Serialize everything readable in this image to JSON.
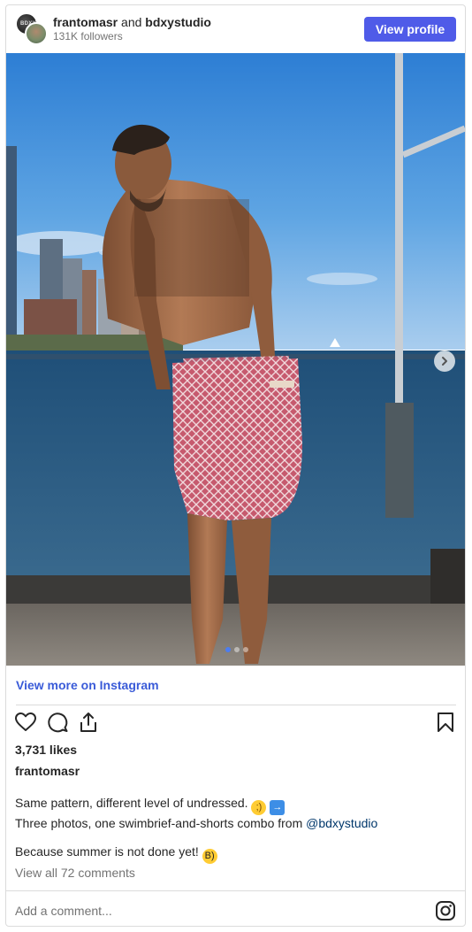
{
  "header": {
    "account_primary": "frantomasr",
    "conjunction": "and",
    "account_secondary": "bdxystudio",
    "followers": "131K followers",
    "view_profile_label": "View profile"
  },
  "photo": {
    "carousel_total": 3,
    "carousel_active": 1
  },
  "view_more_label": "View more on Instagram",
  "likes": "3,731 likes",
  "poster": "frantomasr",
  "caption": {
    "line1": "Same pattern, different level of undressed.",
    "line2_prefix": "Three photos, one swimbrief-and-shorts combo from",
    "mention": "@bdxystudio",
    "line3": "Because summer is not done yet!"
  },
  "view_comments": "View all 72 comments",
  "comment_placeholder": "Add a comment...",
  "colors": {
    "accent_button": "#4f5be8",
    "link_blue": "#3a5bd8",
    "mention": "#00376b"
  },
  "icons": [
    "heart-icon",
    "comment-icon",
    "share-icon",
    "bookmark-icon",
    "instagram-icon",
    "chevron-right-icon"
  ]
}
